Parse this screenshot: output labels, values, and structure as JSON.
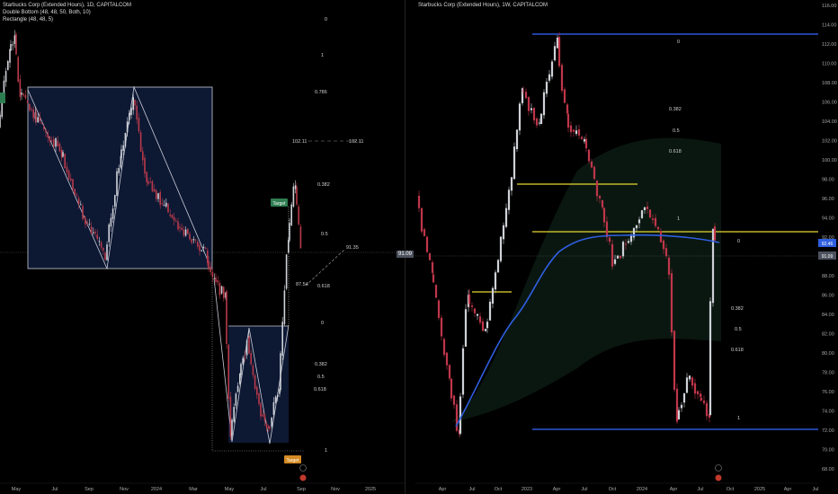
{
  "left_chart": {
    "title": "Starbucks Corp (Extended Hours), 1D, CAPITALCOM",
    "indicators": [
      "Double Bottom (48, 48, 50, Both, 10)",
      "Rectangle (48, 48, 5)"
    ],
    "x_labels": [
      "May",
      "Jul",
      "Sep",
      "Nov",
      "2024",
      "Mar",
      "May",
      "Jul",
      "Sep",
      "Nov",
      "2025"
    ],
    "fib_upper": [
      "0",
      "1",
      "0.786",
      "102.11",
      "102.11",
      "0.382",
      "0.5",
      "91.35",
      "0.618",
      "87.54"
    ],
    "fib_lower": [
      "0",
      "0.382",
      "0.5",
      "0.618",
      "1"
    ],
    "badge_target_top": "Target",
    "badge_target_bottom": "Target",
    "colors": {
      "up": "#cfd2d8",
      "down": "#b83a4a",
      "rect_fill": "#0d1833",
      "rect_line": "#c9ccd6"
    }
  },
  "right_chart": {
    "title": "Starbucks Corp (Extended Hours), 1W, CAPITALCOM",
    "y_labels": [
      "116.00",
      "114.00",
      "112.00",
      "110.00",
      "108.00",
      "106.00",
      "104.00",
      "102.00",
      "100.00",
      "98.00",
      "96.00",
      "94.00",
      "92.00",
      "90.00",
      "88.00",
      "86.00",
      "84.00",
      "82.00",
      "80.00",
      "78.00",
      "76.00",
      "74.00",
      "72.00",
      "70.00",
      "68.00"
    ],
    "x_labels": [
      "Apr",
      "Jul",
      "Oct",
      "2023",
      "Apr",
      "Jul",
      "Oct",
      "2024",
      "Apr",
      "Jul",
      "Oct",
      "2025",
      "Apr",
      "Jul"
    ],
    "fib_upper": [
      "0",
      "0.382",
      "0.5",
      "0.618",
      "1"
    ],
    "fib_lower": [
      "0",
      "0.382",
      "0.5",
      "0.618",
      "1"
    ],
    "price_tag_blue": "92.46",
    "price_tag_grey": "91.09",
    "shared_price_tag": "91.09",
    "colors": {
      "blue_line": "#2d57d8",
      "yellow_line": "#e8d730",
      "ma": "#2f5fe0"
    }
  }
}
